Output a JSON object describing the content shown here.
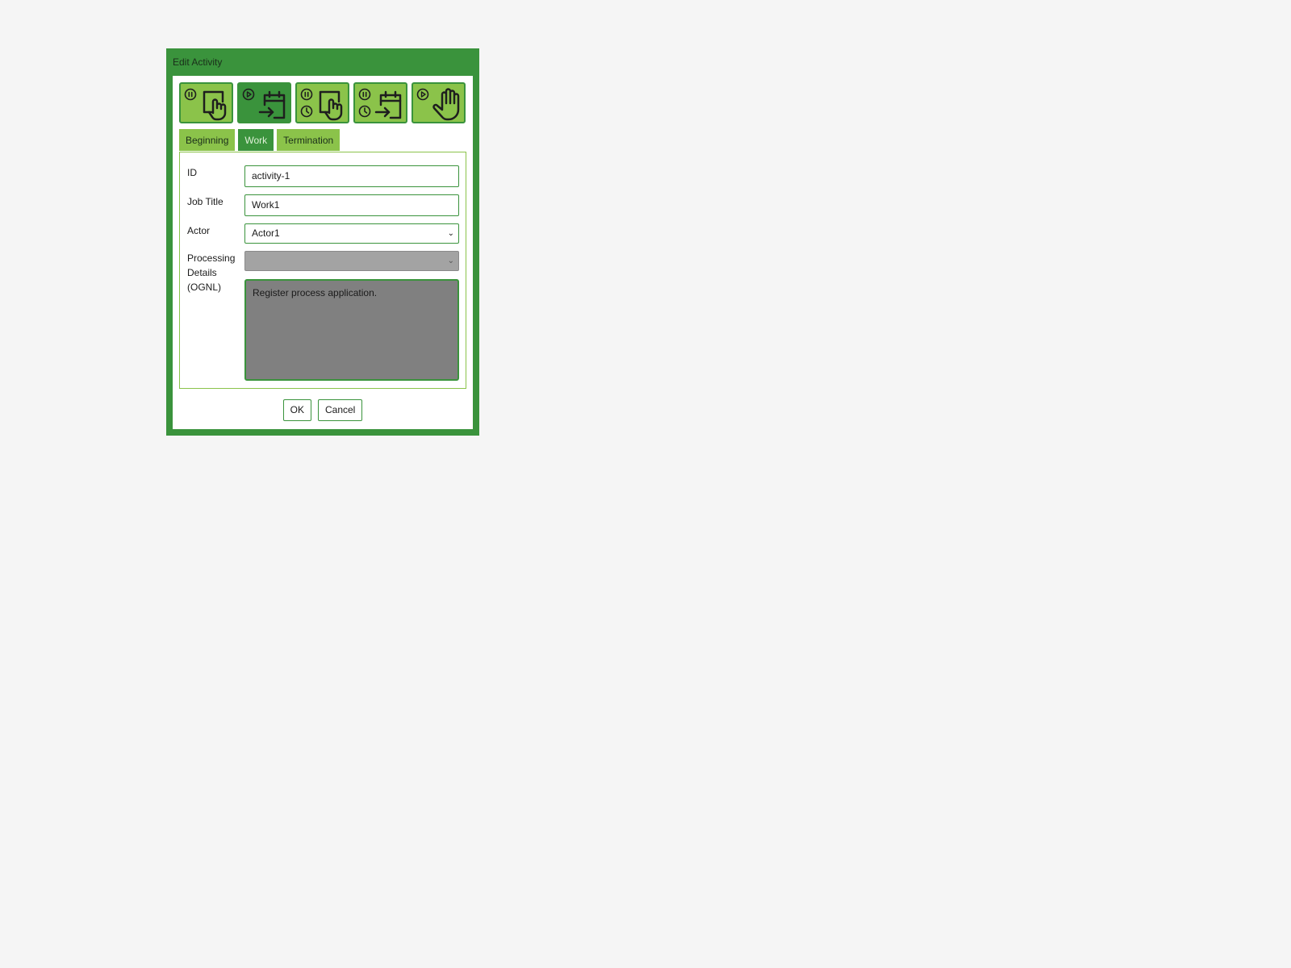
{
  "dialog": {
    "title": "Edit Activity",
    "colors": {
      "frame": "#3a933c",
      "light": "#8bc34a",
      "active": "#3a933c"
    }
  },
  "type_buttons": [
    {
      "icon": "pause-touch-icon",
      "active": false
    },
    {
      "icon": "play-calendar-arrow-icon",
      "active": true
    },
    {
      "icon": "pause-timer-touch-icon",
      "active": false
    },
    {
      "icon": "pause-timer-calendar-arrow-icon",
      "active": false
    },
    {
      "icon": "play-hand-stop-icon",
      "active": false
    }
  ],
  "tabs": [
    {
      "label": "Beginning",
      "active": false
    },
    {
      "label": "Work",
      "active": true
    },
    {
      "label": "Termination",
      "active": false
    }
  ],
  "form": {
    "id_label": "ID",
    "id_value": "activity-1",
    "job_title_label": "Job Title",
    "job_title_value": "Work1",
    "actor_label": "Actor",
    "actor_value": "Actor1",
    "processing_label_1": "Processing",
    "processing_label_2": "Details",
    "processing_label_3": "(OGNL)",
    "processing_select_value": "",
    "processing_text": "Register process application."
  },
  "footer": {
    "ok_label": "OK",
    "cancel_label": "Cancel"
  }
}
